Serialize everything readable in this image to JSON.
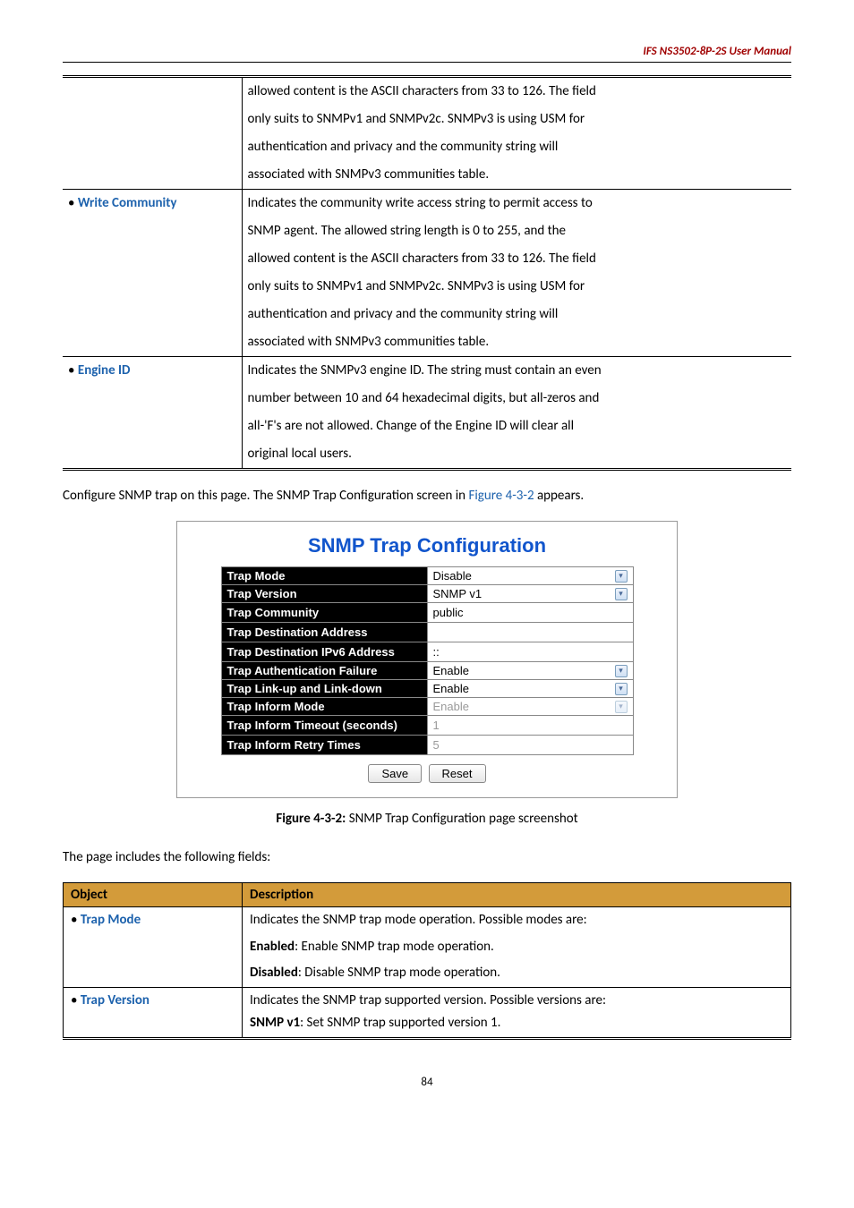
{
  "header": {
    "title": "IFS  NS3502-8P-2S  User  Manual"
  },
  "table1": {
    "cont_desc_l1": "allowed content is the ASCII characters from 33 to 126. The field",
    "cont_desc_l2": "only suits to SNMPv1 and SNMPv2c. SNMPv3 is using USM for",
    "cont_desc_l3": "authentication and privacy and the community string will",
    "cont_desc_l4": "associated with SNMPv3 communities table.",
    "row2_label": "Write Community",
    "row2_l1": "Indicates the community write access string to permit access to",
    "row2_l2": "SNMP agent. The allowed string length is 0 to 255, and the",
    "row2_l3": "allowed content is the ASCII characters from 33 to 126. The field",
    "row2_l4": "only suits to SNMPv1 and SNMPv2c. SNMPv3 is using USM for",
    "row2_l5": "authentication and privacy and the community string will",
    "row2_l6": "associated with SNMPv3 communities table.",
    "row3_label": "Engine ID",
    "row3_l1": "Indicates the SNMPv3 engine ID. The string must contain an even",
    "row3_l2": "number between 10 and 64 hexadecimal digits, but all-zeros and",
    "row3_l3": "all-'F's are not allowed. Change of the Engine ID will clear all",
    "row3_l4": "original local users."
  },
  "para1_a": "Configure SNMP trap on this page. The SNMP Trap Configuration screen in ",
  "para1_link": "Figure 4-3-2",
  "para1_b": " appears.",
  "panel": {
    "title": "SNMP Trap Configuration",
    "rows": {
      "trap_mode": {
        "label": "Trap Mode",
        "value": "Disable"
      },
      "trap_version": {
        "label": "Trap Version",
        "value": "SNMP v1"
      },
      "trap_community": {
        "label": "Trap Community",
        "value": "public"
      },
      "trap_dest_addr": {
        "label": "Trap Destination Address",
        "value": ""
      },
      "trap_dest_ipv6": {
        "label": "Trap Destination IPv6 Address",
        "value": "::"
      },
      "trap_auth_fail": {
        "label": "Trap Authentication Failure",
        "value": "Enable"
      },
      "trap_link": {
        "label": "Trap Link-up and Link-down",
        "value": "Enable"
      },
      "trap_inform_mode": {
        "label": "Trap Inform Mode",
        "value": "Enable"
      },
      "trap_inform_timeout": {
        "label": "Trap Inform Timeout (seconds)",
        "value": "1"
      },
      "trap_inform_retry": {
        "label": "Trap Inform Retry Times",
        "value": "5"
      }
    },
    "buttons": {
      "save": "Save",
      "reset": "Reset"
    }
  },
  "caption_bold": "Figure 4-3-2:",
  "caption_rest": " SNMP Trap Configuration page screenshot",
  "para2": "The page includes the following fields:",
  "fields": {
    "h_object": "Object",
    "h_desc": "Description",
    "trap_mode_label": "Trap Mode",
    "trap_mode_l1": "Indicates the SNMP trap mode operation. Possible modes are:",
    "trap_mode_l2a": "Enabled",
    "trap_mode_l2b": ": Enable SNMP trap mode operation.",
    "trap_mode_l3a": "Disabled",
    "trap_mode_l3b": ": Disable SNMP trap mode operation.",
    "trap_version_label": "Trap Version",
    "trap_version_l1": "Indicates the SNMP trap supported version. Possible versions are:",
    "trap_version_l2a": "SNMP v1",
    "trap_version_l2b": ": Set SNMP trap supported version 1."
  },
  "footer": "84"
}
